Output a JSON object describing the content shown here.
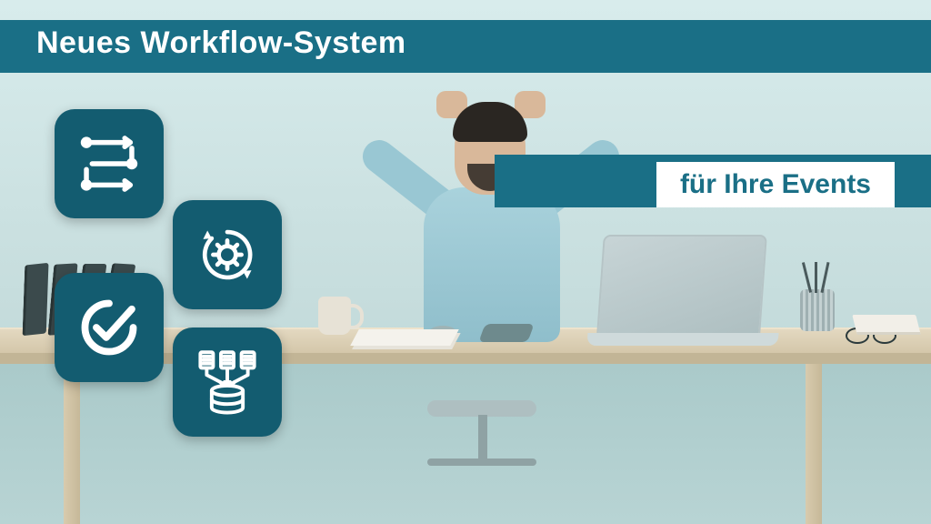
{
  "headline": "Neues Workflow-System",
  "subheadline": "für Ihre Events",
  "icons": {
    "flow": "workflow-path-icon",
    "gear": "gear-cycle-icon",
    "check": "checkmark-circle-icon",
    "data": "documents-to-database-icon"
  },
  "colors": {
    "teal_band": "#1a6f86",
    "card": "#135c70",
    "white": "#ffffff"
  }
}
